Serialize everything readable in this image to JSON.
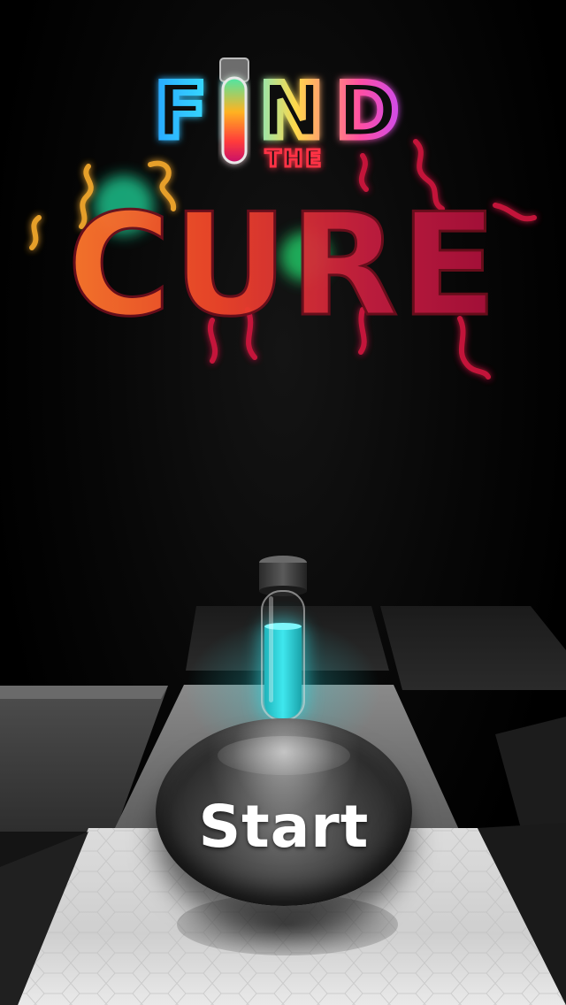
{
  "title": {
    "line1": "FIND",
    "line2": "THE",
    "line3": "CURE"
  },
  "start_button": {
    "label": "Start"
  },
  "colors": {
    "background": "#000000",
    "tube_liquid": "#2fd6dd",
    "cure_orange": "#ff6a2a",
    "cure_red": "#b31238",
    "blob_green": "#1fbf8a"
  },
  "icons": {
    "logo_tube": "test-tube-icon",
    "tube": "test-tube-icon"
  }
}
